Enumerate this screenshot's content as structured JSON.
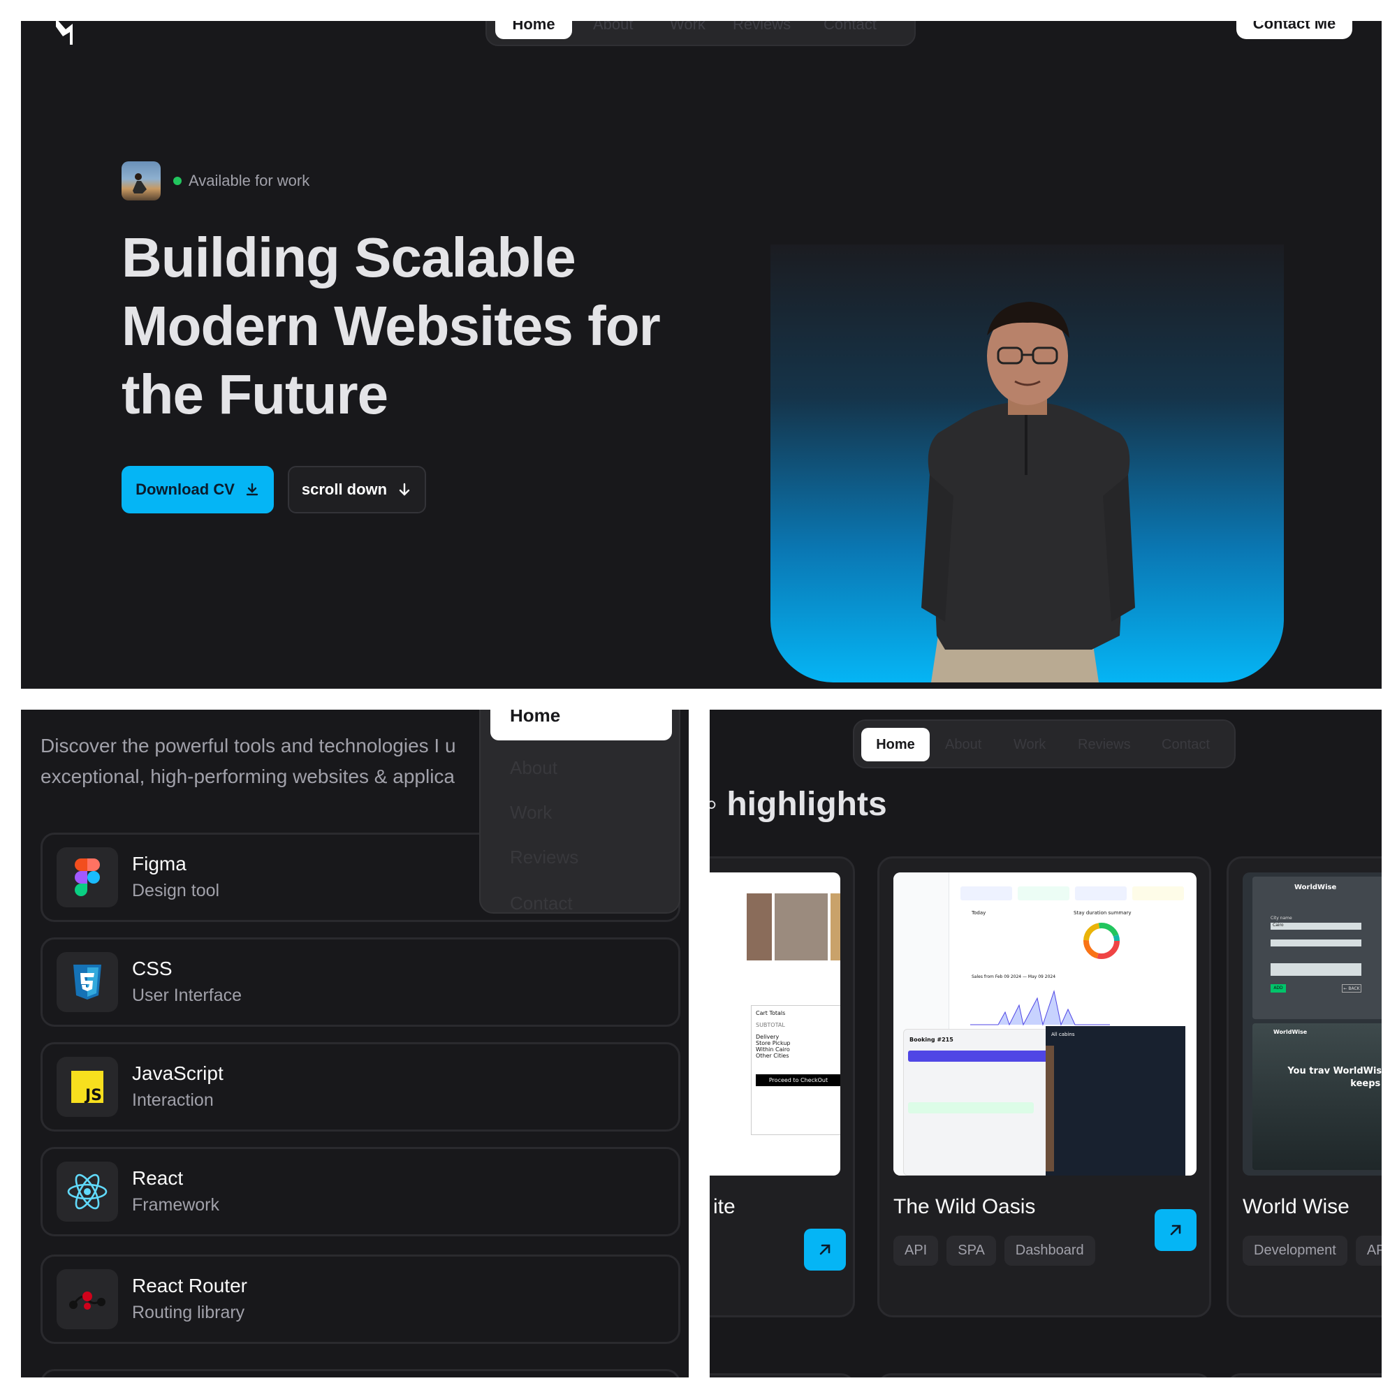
{
  "hero": {
    "nav": {
      "home": "Home",
      "items": [
        "About",
        "Work",
        "Reviews",
        "Contact"
      ]
    },
    "contact_button": "Contact Me",
    "availability": "Available for work",
    "headline": "Building Scalable Modern Websites for the Future",
    "download_cv": "Download CV",
    "scroll_down": "scroll down"
  },
  "tools": {
    "description": "Discover the powerful tools and technologies I u exceptional, high-performing websites & applica",
    "dropdown_nav": {
      "home": "Home",
      "items": [
        "About",
        "Work",
        "Reviews",
        "Contact"
      ]
    },
    "items": [
      {
        "name": "Figma",
        "desc": "Design tool",
        "icon": "figma-icon"
      },
      {
        "name": "CSS",
        "desc": "User Interface",
        "icon": "css-icon"
      },
      {
        "name": "JavaScript",
        "desc": "Interaction",
        "icon": "javascript-icon"
      },
      {
        "name": "React",
        "desc": "Framework",
        "icon": "react-icon"
      },
      {
        "name": "React Router",
        "desc": "Routing library",
        "icon": "react-router-icon"
      }
    ]
  },
  "projects": {
    "nav": {
      "home": "Home",
      "items": [
        "About",
        "Work",
        "Reviews",
        "Contact"
      ]
    },
    "title": "highlights",
    "cards": [
      {
        "title": "ite",
        "tags": [],
        "shot": {
          "cart": "Cart Totals",
          "subtotal": "SUBTOTAL",
          "delivery": "Delivery",
          "options": [
            "Store Pickup",
            "Within Cairo",
            "Other Cities"
          ],
          "checkout": "Proceed to CheckOut"
        }
      },
      {
        "title": "The Wild Oasis",
        "tags": [
          "API",
          "SPA",
          "Dashboard"
        ],
        "shot": {
          "booking": "Booking #215",
          "cabins": "All cabins",
          "today": "Today",
          "summary": "Stay duration summary",
          "sales": "Sales from Feb 09 2024 — May 09 2024"
        }
      },
      {
        "title": "World Wise",
        "tags": [
          "Development",
          "AP"
        ],
        "shot": {
          "brand": "WorldWise",
          "city_label": "City name",
          "city": "Cairo",
          "add": "ADD",
          "back": "← BACK",
          "tagline": "You trav WorldWise keeps t"
        }
      }
    ]
  },
  "colors": {
    "accent": "#05b5f5",
    "bg": "#18181b",
    "available": "#22c55e"
  }
}
